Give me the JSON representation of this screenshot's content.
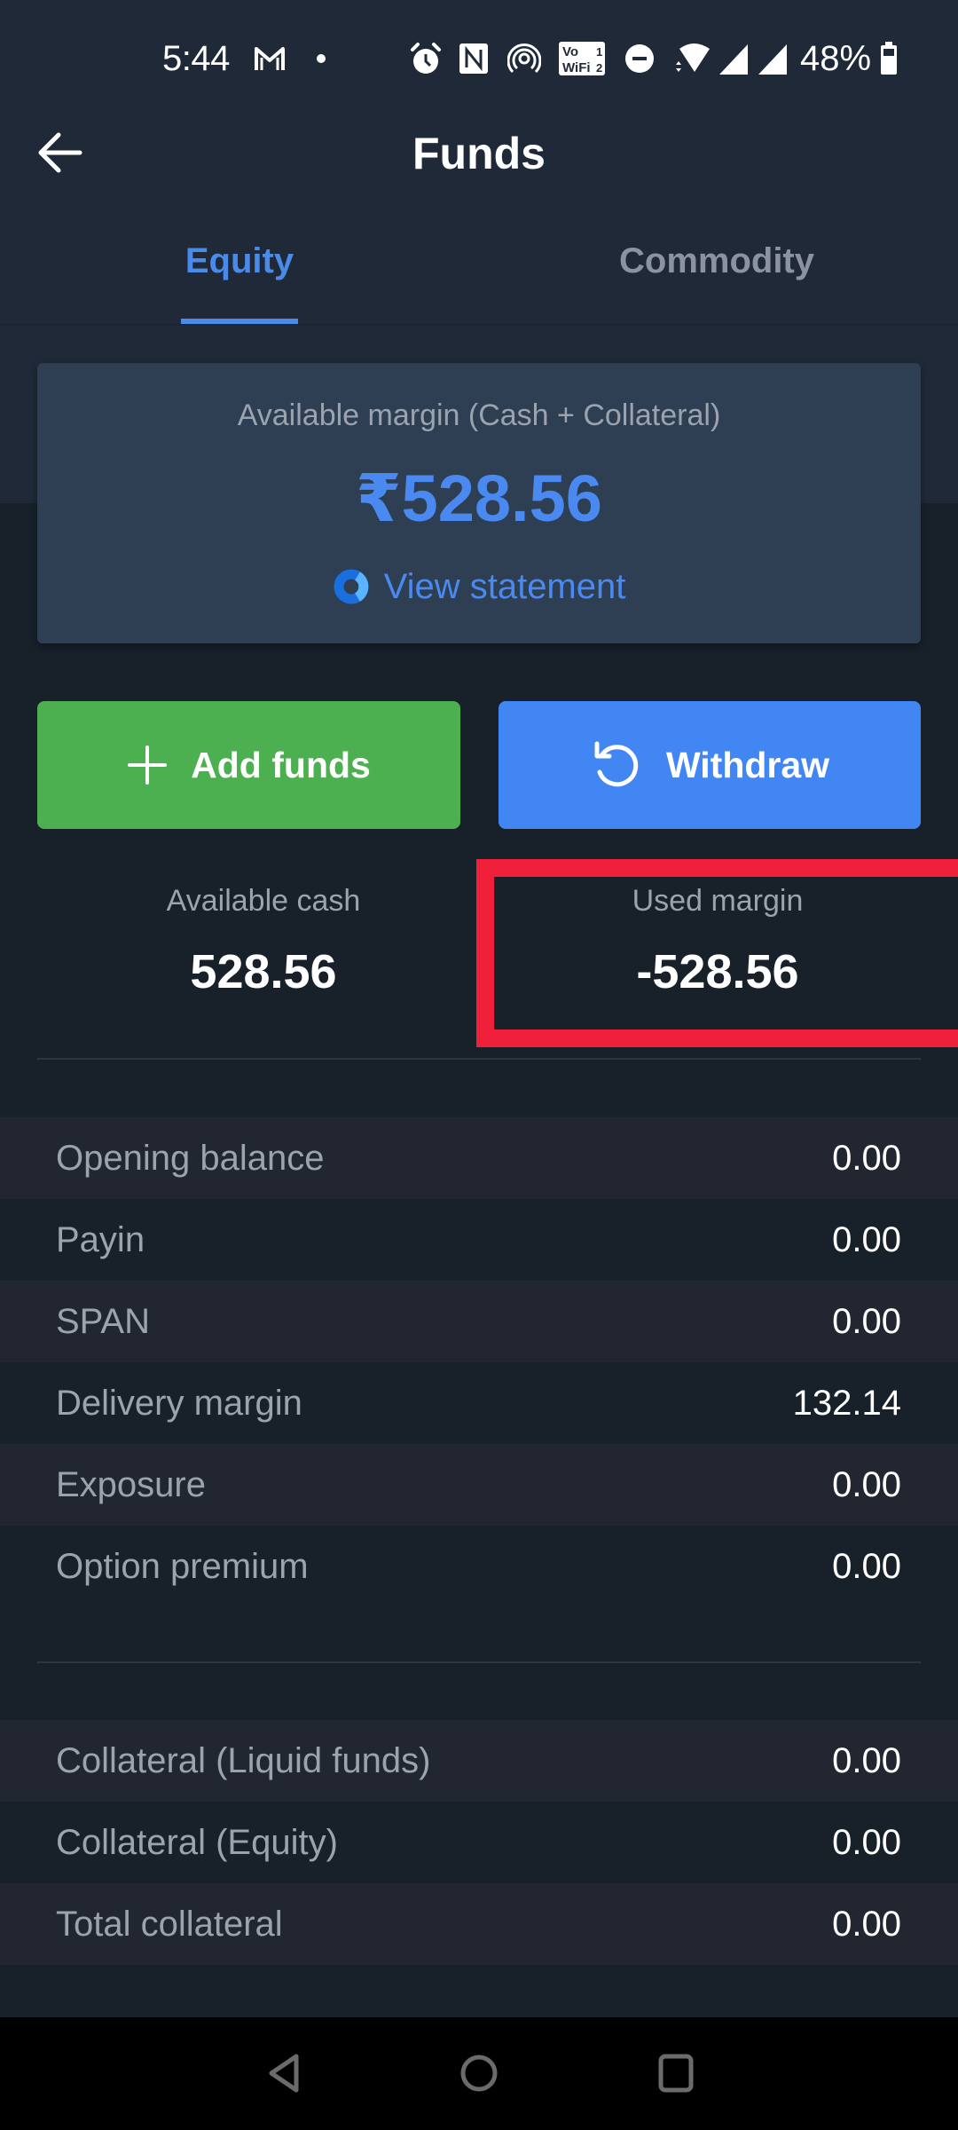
{
  "status_bar": {
    "time": "5:44",
    "battery_percent": "48%",
    "icons": [
      "gmail-icon",
      "notification-dot-icon",
      "alarm-icon",
      "nfc-icon",
      "hotspot-icon",
      "vowifi-icon",
      "dnd-icon",
      "wifi-icon",
      "signal-1-icon",
      "signal-2-icon",
      "battery-icon"
    ],
    "vowifi_line1": "Vo",
    "vowifi_line2": "WiFi",
    "vowifi_sim1": "1",
    "vowifi_sim2": "2"
  },
  "header": {
    "back_icon": "arrow-left-icon",
    "title": "Funds"
  },
  "tabs": [
    {
      "label": "Equity",
      "active": true
    },
    {
      "label": "Commodity",
      "active": false
    }
  ],
  "margin_card": {
    "label": "Available margin (Cash + Collateral)",
    "amount": "₹528.56",
    "view_statement_label": "View statement",
    "view_statement_icon": "console-logo-icon"
  },
  "actions": {
    "add_funds_label": "Add funds",
    "add_funds_icon": "plus-icon",
    "withdraw_label": "Withdraw",
    "withdraw_icon": "refresh-icon"
  },
  "stats": {
    "available_cash_label": "Available cash",
    "available_cash_value": "528.56",
    "used_margin_label": "Used margin",
    "used_margin_value": "-528.56"
  },
  "breakdown": [
    {
      "label": "Opening balance",
      "value": "0.00"
    },
    {
      "label": "Payin",
      "value": "0.00"
    },
    {
      "label": "SPAN",
      "value": "0.00"
    },
    {
      "label": "Delivery margin",
      "value": "132.14"
    },
    {
      "label": "Exposure",
      "value": "0.00"
    },
    {
      "label": "Option premium",
      "value": "0.00"
    }
  ],
  "collateral": [
    {
      "label": "Collateral (Liquid funds)",
      "value": "0.00"
    },
    {
      "label": "Collateral (Equity)",
      "value": "0.00"
    },
    {
      "label": "Total collateral",
      "value": "0.00"
    }
  ],
  "colors": {
    "accent_blue": "#4a8af0",
    "add_funds_green": "#4caf50",
    "withdraw_blue": "#4286f4",
    "highlight_red": "#f0203a"
  },
  "nav_bar": {
    "icons": [
      "nav-back-icon",
      "nav-home-icon",
      "nav-recents-icon"
    ]
  }
}
